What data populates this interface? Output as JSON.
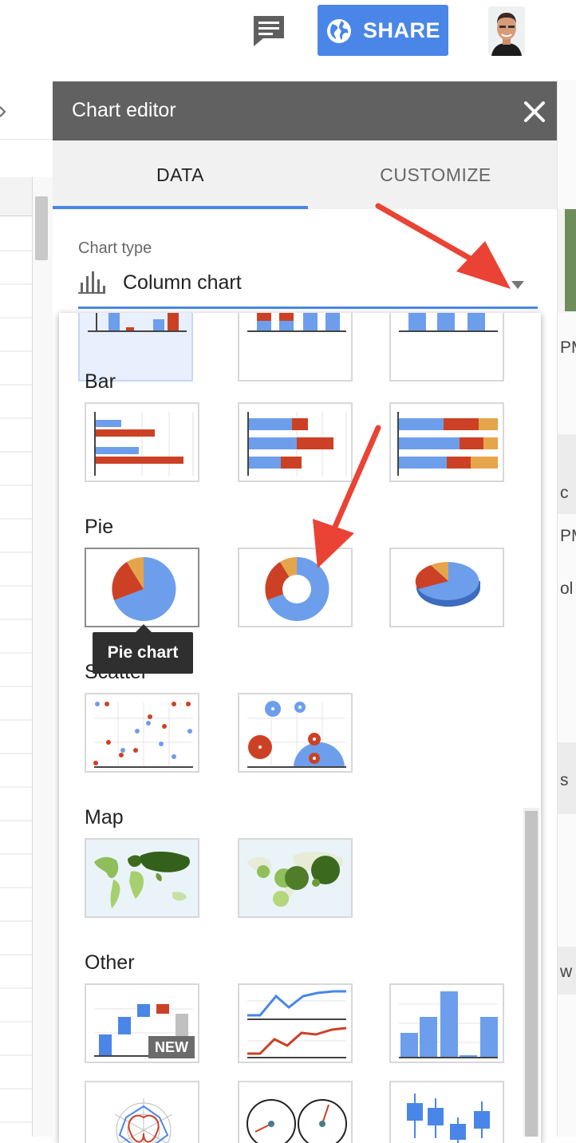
{
  "topbar": {
    "share_label": "SHARE",
    "comments_icon": "comment-icon",
    "share_icon": "globe-icon"
  },
  "right_strip": {
    "texts": [
      "PM",
      "c",
      "PM",
      "ol",
      "s",
      "w"
    ]
  },
  "chart_editor": {
    "title": "Chart editor",
    "close_icon": "close-icon",
    "tabs": [
      {
        "label": "DATA",
        "active": true
      },
      {
        "label": "CUSTOMIZE",
        "active": false
      }
    ],
    "chart_type_label": "Chart type",
    "chart_type_value": "Column chart",
    "accent_color": "#4a86e8"
  },
  "dropdown": {
    "sections": [
      {
        "label": "Bar"
      },
      {
        "label": "Pie"
      },
      {
        "label": "Scatter"
      },
      {
        "label": "Map"
      },
      {
        "label": "Other"
      }
    ],
    "tooltip": "Pie chart",
    "new_badge": "NEW"
  },
  "colors": {
    "blue": "#6d9eeb",
    "red": "#cc4125",
    "orange": "#e6a54a",
    "arrow": "#ea4335",
    "header": "#616161"
  }
}
